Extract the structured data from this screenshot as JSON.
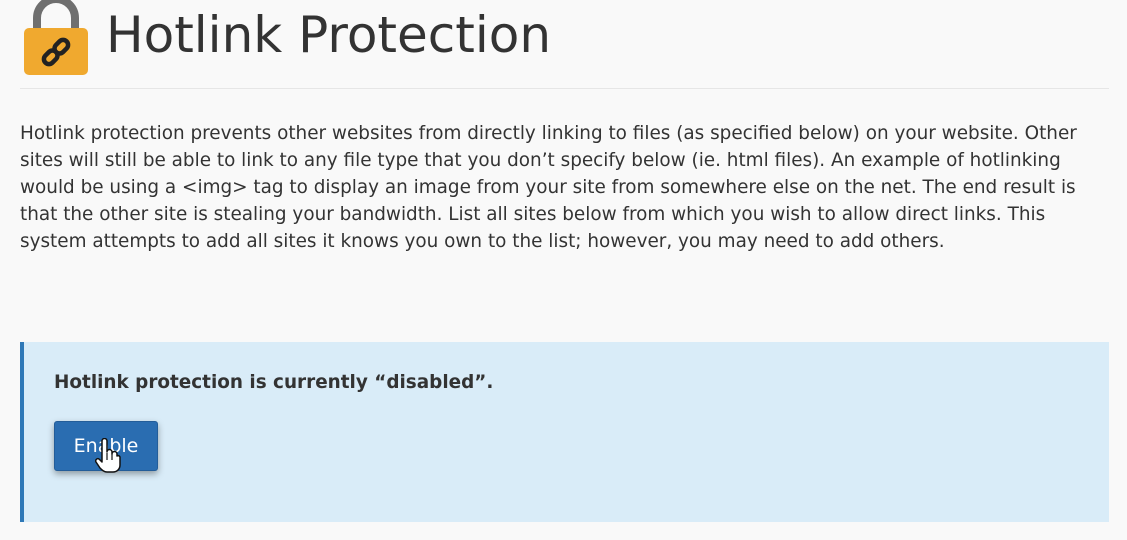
{
  "header": {
    "title": "Hotlink Protection",
    "icon": "padlock-link-icon",
    "icon_color": "#f0a92f"
  },
  "description": "Hotlink protection prevents other websites from directly linking to files (as specified below) on your website. Other sites will still be able to link to any file type that you don’t specify below (ie. html files). An example of hotlinking would be using a <img> tag to display an image from your site from somewhere else on the net. The end result is that the other site is stealing your bandwidth. List all sites below from which you wish to allow direct links. This system attempts to add all sites it knows you own to the list; however, you may need to add others.",
  "status_alert": {
    "message": "Hotlink protection is currently “disabled”.",
    "background_color": "#d9ecf8",
    "border_color": "#2e78b7"
  },
  "enable_button": {
    "label": "Enable",
    "color": "#2a6db1"
  },
  "cursor": {
    "icon": "hand-pointer-icon"
  }
}
